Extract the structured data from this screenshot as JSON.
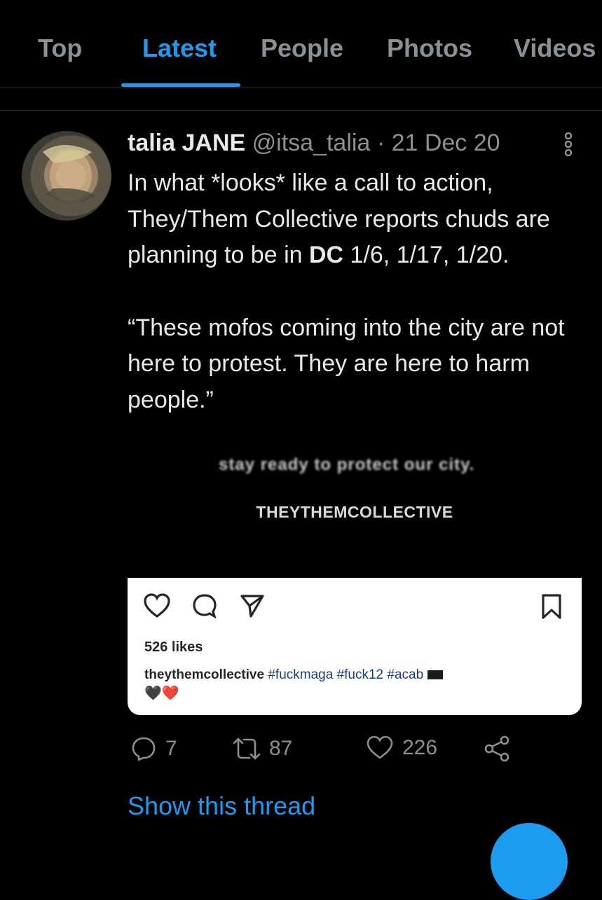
{
  "tabs": [
    "Top",
    "Latest",
    "People",
    "Photos",
    "Videos"
  ],
  "active_tab": "Latest",
  "tweet": {
    "author_name": "talia JANE",
    "handle": "@itsa_talia",
    "date": "· 21 Dec 20",
    "text_line1_a": "In what *looks* like a call to action, They/Them Collective reports chuds are planning to be in ",
    "text_line1_bold": "DC",
    "text_line1_b": " 1/6, 1/17, 1/20.",
    "quote": "“These mofos coming into the city are not here to protest. They are here to harm people.”",
    "media": {
      "cut_text": "stay ready to protect our city.",
      "collective": "THEYTHEMCOLLECTIVE",
      "likes": "526 likes",
      "caption_user": "theythemcollective",
      "caption_tags": "#fuckmaga #fuck12 #acab",
      "hearts": "🖤❤️"
    },
    "replies": "7",
    "retweets": "87",
    "likes": "226",
    "show_thread": "Show this thread"
  },
  "colors": {
    "accent": "#1d9bf0",
    "muted": "#8b9094",
    "text": "#e7e9ea",
    "background": "#000000"
  },
  "icons": [
    "more-vertical-icon",
    "reply-icon",
    "retweet-icon",
    "like-icon",
    "share-icon",
    "heart-outline-icon",
    "comment-bubble-icon",
    "send-icon",
    "bookmark-icon"
  ]
}
